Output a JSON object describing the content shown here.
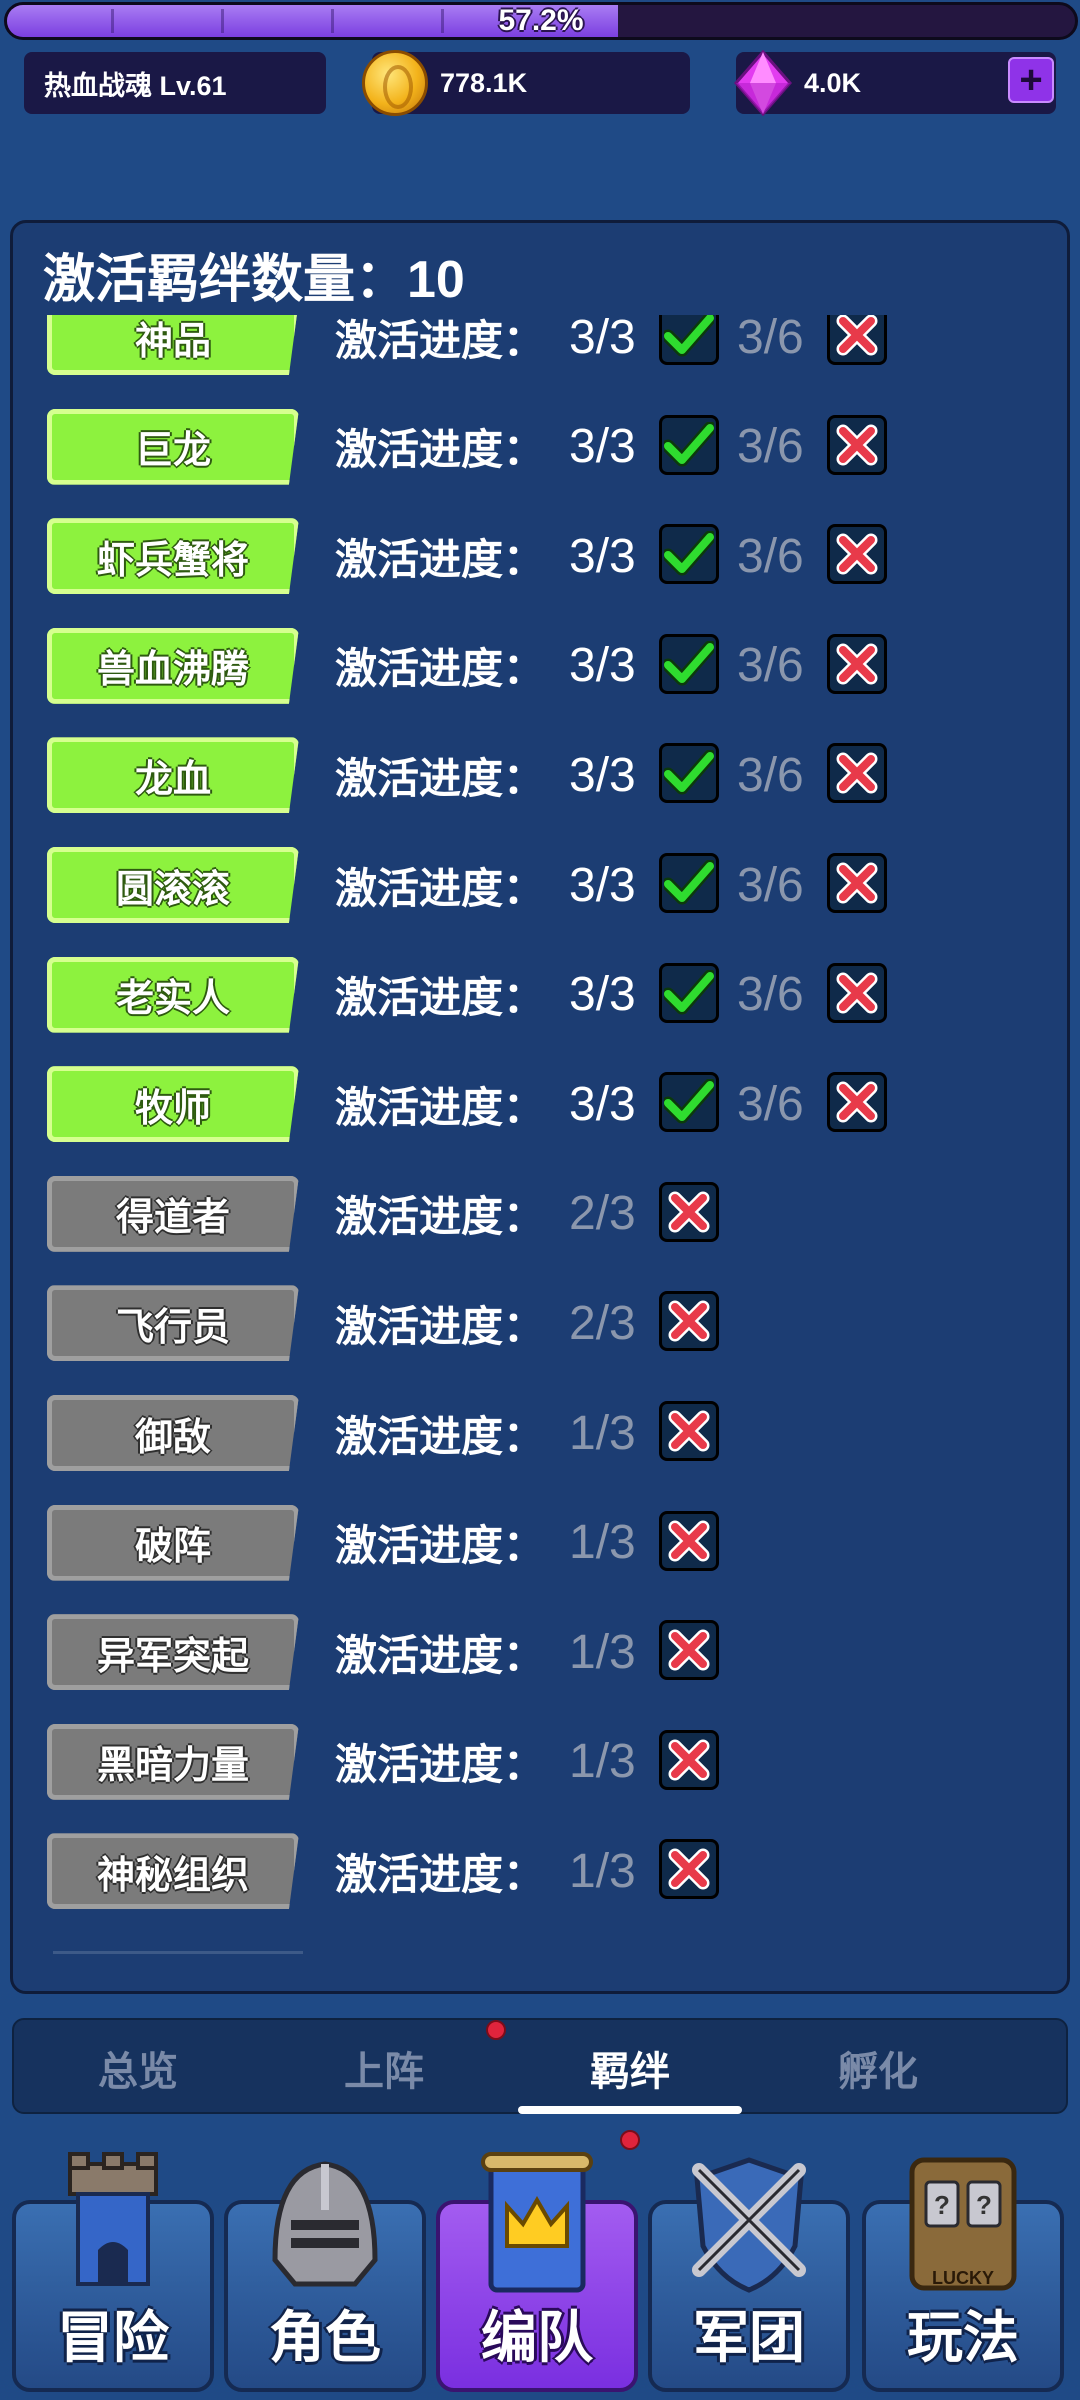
{
  "xp": {
    "percent_text": "57.2%",
    "fraction": 0.572
  },
  "player": {
    "name_level": "热血战魂 Lv.61"
  },
  "currency": {
    "coins": "778.1K",
    "gems": "4.0K",
    "plus": "+"
  },
  "panel": {
    "title": "激活羁绊数量：10",
    "progress_label": "激活进度：",
    "bonds": [
      {
        "name": "神品",
        "active": true,
        "progress": "3/3",
        "progress_done": true,
        "next": "3/6",
        "next_done": false
      },
      {
        "name": "巨龙",
        "active": true,
        "progress": "3/3",
        "progress_done": true,
        "next": "3/6",
        "next_done": false
      },
      {
        "name": "虾兵蟹将",
        "active": true,
        "progress": "3/3",
        "progress_done": true,
        "next": "3/6",
        "next_done": false
      },
      {
        "name": "兽血沸腾",
        "active": true,
        "progress": "3/3",
        "progress_done": true,
        "next": "3/6",
        "next_done": false
      },
      {
        "name": "龙血",
        "active": true,
        "progress": "3/3",
        "progress_done": true,
        "next": "3/6",
        "next_done": false
      },
      {
        "name": "圆滚滚",
        "active": true,
        "progress": "3/3",
        "progress_done": true,
        "next": "3/6",
        "next_done": false
      },
      {
        "name": "老实人",
        "active": true,
        "progress": "3/3",
        "progress_done": true,
        "next": "3/6",
        "next_done": false
      },
      {
        "name": "牧师",
        "active": true,
        "progress": "3/3",
        "progress_done": true,
        "next": "3/6",
        "next_done": false
      },
      {
        "name": "得道者",
        "active": false,
        "progress": "2/3",
        "progress_done": false
      },
      {
        "name": "飞行员",
        "active": false,
        "progress": "2/3",
        "progress_done": false
      },
      {
        "name": "御敌",
        "active": false,
        "progress": "1/3",
        "progress_done": false
      },
      {
        "name": "破阵",
        "active": false,
        "progress": "1/3",
        "progress_done": false
      },
      {
        "name": "异军突起",
        "active": false,
        "progress": "1/3",
        "progress_done": false
      },
      {
        "name": "黑暗力量",
        "active": false,
        "progress": "1/3",
        "progress_done": false
      },
      {
        "name": "神秘组织",
        "active": false,
        "progress": "1/3",
        "progress_done": false
      }
    ]
  },
  "subtabs": [
    {
      "label": "总览",
      "active": false
    },
    {
      "label": "上阵",
      "active": false,
      "dot": true
    },
    {
      "label": "羁绊",
      "active": true
    },
    {
      "label": "孵化",
      "active": false
    }
  ],
  "nav": [
    {
      "label": "冒险",
      "icon": "tower-icon",
      "active": false
    },
    {
      "label": "角色",
      "icon": "helmet-icon",
      "active": false
    },
    {
      "label": "编队",
      "icon": "crown-banner-icon",
      "active": true,
      "dot": true
    },
    {
      "label": "军团",
      "icon": "crossed-swords-shield-icon",
      "active": false
    },
    {
      "label": "玩法",
      "icon": "slot-machine-icon",
      "active": false,
      "icon_text": "LUCKY"
    }
  ],
  "colors": {
    "background": "#1f4a86",
    "active_tag": "#8df23e",
    "inactive_tag": "#7b7b7b",
    "check": "#2fdc2f",
    "cross": "#e83a4a",
    "accent_purple": "#8f33e8"
  }
}
